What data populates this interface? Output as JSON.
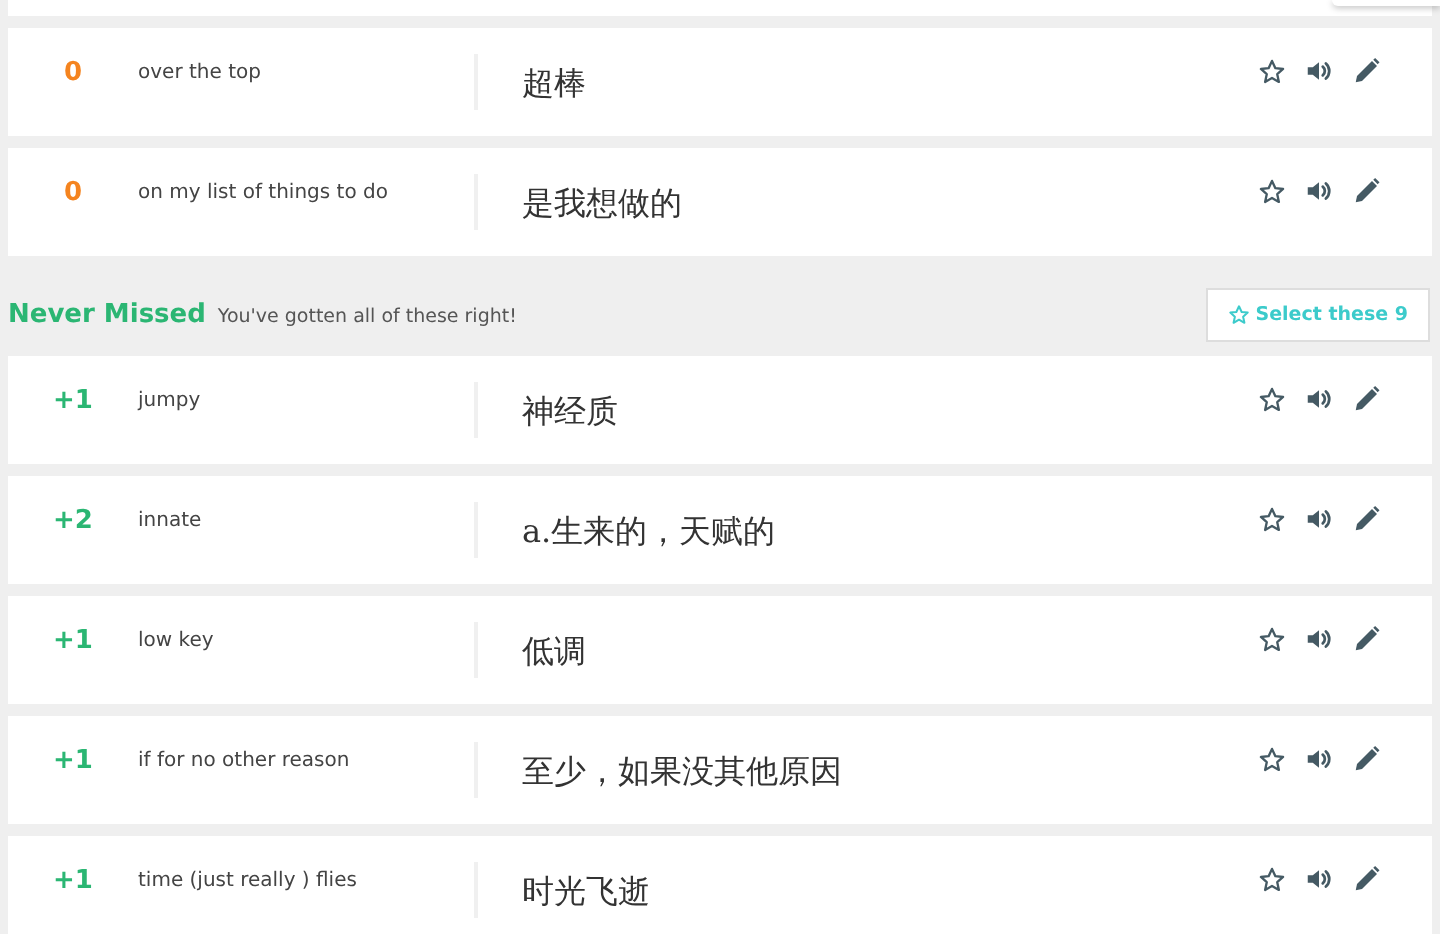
{
  "sections": [
    {
      "items": [
        {
          "score": "0",
          "color": "#f5841f",
          "term": "over the top",
          "definition": "超棒",
          "starred": false
        },
        {
          "score": "0",
          "color": "#f5841f",
          "term": "on my list of things to do",
          "definition": "是我想做的",
          "starred": false
        }
      ]
    },
    {
      "title": "Never Missed",
      "subtitle": "You've gotten all of these right!",
      "button": "Select these 9",
      "items": [
        {
          "score": "+1",
          "color": "#2bb673",
          "term": "jumpy",
          "definition": "神经质",
          "starred": false
        },
        {
          "score": "+2",
          "color": "#2bb673",
          "term": "innate",
          "definition": "a.生来的，天赋的",
          "starred": false
        },
        {
          "score": "+1",
          "color": "#2bb673",
          "term": "low key",
          "definition": "低调",
          "starred": false
        },
        {
          "score": "+1",
          "color": "#2bb673",
          "term": "if for no other reason",
          "definition": "至少，如果没其他原因",
          "starred": false
        },
        {
          "score": "+1",
          "color": "#2bb673",
          "term": "time (just really ) flies",
          "definition": "时光飞逝",
          "starred": false
        }
      ]
    }
  ]
}
